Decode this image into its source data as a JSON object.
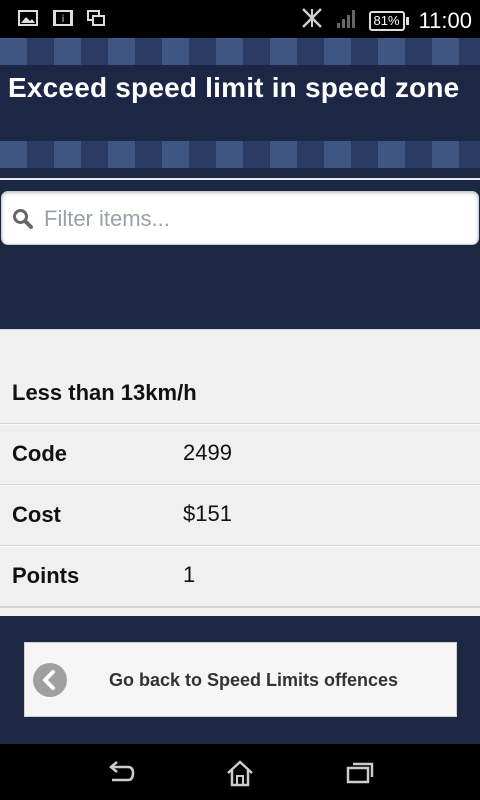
{
  "status_bar": {
    "battery": "81%",
    "time": "11:00",
    "icons": [
      "image-icon",
      "info-icon",
      "screens-icon",
      "no-signal-icon",
      "signal-icon",
      "battery-icon"
    ]
  },
  "header": {
    "title": "Exceed speed limit in speed zone",
    "colors": {
      "background": "#1b2744",
      "check_light": "#3f5682",
      "check_mid": "#2b3b63"
    }
  },
  "search": {
    "placeholder": "Filter items...",
    "value": "",
    "icon": "search-icon"
  },
  "offence": {
    "section_title": "Less than 13km/h",
    "rows": [
      {
        "label": "Code",
        "value": "2499"
      },
      {
        "label": "Cost",
        "value": "$151"
      },
      {
        "label": "Points",
        "value": "1"
      }
    ]
  },
  "footer": {
    "back_label": "Go back to Speed Limits offences",
    "back_icon": "chevron-left-icon"
  },
  "nav_bar": {
    "icons": [
      "back-arrow-icon",
      "home-icon",
      "recent-apps-icon"
    ]
  }
}
